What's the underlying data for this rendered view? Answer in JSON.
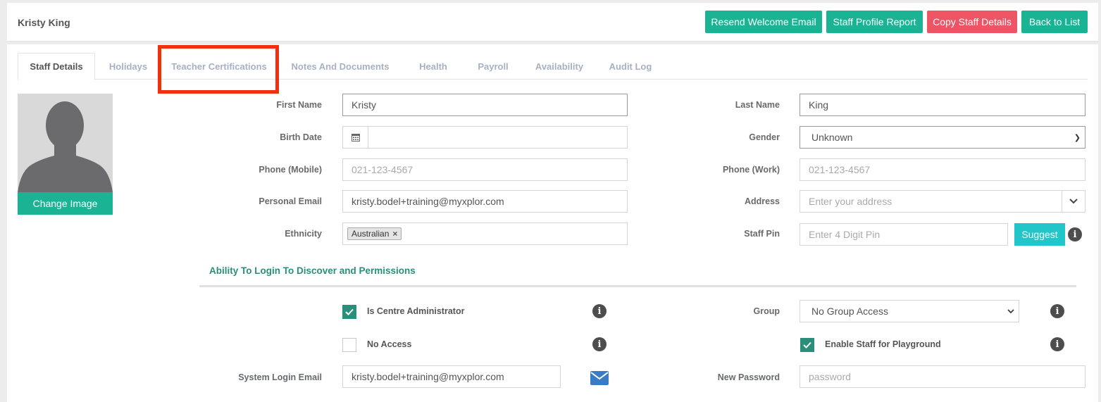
{
  "header": {
    "title": "Kristy King",
    "buttons": {
      "resend": "Resend Welcome Email",
      "report": "Staff Profile Report",
      "copy": "Copy Staff Details",
      "back": "Back to List"
    }
  },
  "tabs": [
    "Staff Details",
    "Holidays",
    "Teacher Certifications",
    "Notes And Documents",
    "Health",
    "Payroll",
    "Availability",
    "Audit Log"
  ],
  "photo": {
    "change_label": "Change Image"
  },
  "form": {
    "first_name": {
      "label": "First Name",
      "value": "Kristy"
    },
    "last_name": {
      "label": "Last Name",
      "value": "King"
    },
    "birth_date": {
      "label": "Birth Date",
      "value": ""
    },
    "gender": {
      "label": "Gender",
      "value": "Unknown"
    },
    "phone_mobile": {
      "label": "Phone (Mobile)",
      "placeholder": "021-123-4567"
    },
    "phone_work": {
      "label": "Phone (Work)",
      "placeholder": "021-123-4567"
    },
    "personal_email": {
      "label": "Personal Email",
      "value": "kristy.bodel+training@myxplor.com"
    },
    "address": {
      "label": "Address",
      "placeholder": "Enter your address"
    },
    "ethnicity": {
      "label": "Ethnicity",
      "tag": "Australian"
    },
    "staff_pin": {
      "label": "Staff Pin",
      "placeholder": "Enter 4 Digit Pin",
      "suggest_label": "Suggest"
    }
  },
  "permissions": {
    "section_title": "Ability To Login To Discover and Permissions",
    "is_admin": {
      "label": "Is Centre Administrator",
      "checked": true
    },
    "no_access": {
      "label": "No Access",
      "checked": false
    },
    "group": {
      "label": "Group",
      "value": "No Group Access"
    },
    "playground": {
      "label": "Enable Staff for Playground",
      "checked": true
    },
    "login_email": {
      "label": "System Login Email",
      "value": "kristy.bodel+training@myxplor.com"
    },
    "new_password": {
      "label": "New Password",
      "placeholder": "password"
    }
  },
  "icons": {
    "calendar": "calendar-icon",
    "info": "info-icon",
    "mail": "envelope-icon",
    "check": "check-icon",
    "chevron": "chevron-down-icon"
  },
  "colors": {
    "teal": "#1ab394",
    "red": "#ed5565",
    "cyan": "#23c6c8",
    "section": "#2a8f7a",
    "highlight": "#f0300f"
  }
}
